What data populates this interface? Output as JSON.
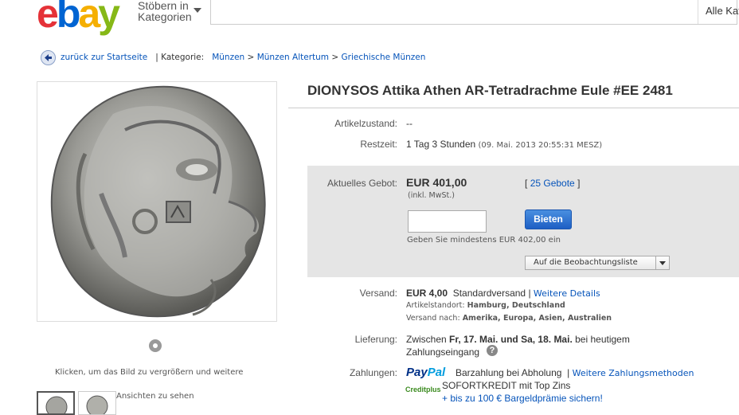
{
  "header": {
    "logo_letters": [
      "e",
      "b",
      "a",
      "y"
    ],
    "logo_colors": [
      "#e53238",
      "#0064d2",
      "#f5af02",
      "#86b817"
    ],
    "browse_line1": "Stöbern in",
    "browse_line2": "Kategorien",
    "category_select": "Alle Kat"
  },
  "breadcrumb": {
    "back_label": "zurück zur Startseite",
    "separator": "|",
    "category_label": "Kategorie:",
    "items": [
      "Münzen",
      "Münzen Altertum",
      "Griechische Münzen"
    ],
    "arrow": ">"
  },
  "gallery": {
    "hint_line1": "Klicken, um das Bild zu vergrößern und weitere",
    "hint_line2": "Ansichten zu sehen"
  },
  "listing": {
    "title": "DIONYSOS Attika Athen AR-Tetradrachme Eule #EE 2481",
    "condition_label": "Artikelzustand:",
    "condition_value": "--",
    "time_label": "Restzeit:",
    "time_value": "1 Tag 3 Stunden",
    "time_end": "(09. Mai. 2013  20:55:31 MESZ)"
  },
  "bidding": {
    "current_label": "Aktuelles Gebot:",
    "price": "EUR 401,00",
    "price_note": "(inkl. MwSt.)",
    "bids_open": "[",
    "bids_link": "25 Gebote",
    "bids_close": "]",
    "bid_input_value": "",
    "bid_button": "Bieten",
    "min_bid_note": "Geben Sie mindestens EUR 402,00 ein",
    "watch_button": "Auf die Beobachtungsliste"
  },
  "shipping": {
    "label": "Versand:",
    "cost": "EUR 4,00",
    "method": "Standardversand",
    "sep": "|",
    "details_link": "Weitere Details",
    "location_label": "Artikelstandort:",
    "location_value": "Hamburg, Deutschland",
    "ships_to_label": "Versand nach:",
    "ships_to_value": "Amerika, Europa, Asien, Australien"
  },
  "delivery": {
    "label": "Lieferung:",
    "prefix": "Zwischen",
    "date_from": "Fr, 17. Mai.",
    "connector": "und",
    "date_to": "Sa, 18. Mai.",
    "suffix": "bei heutigem",
    "line2": "Zahlungseingang",
    "help_icon": "?"
  },
  "payments": {
    "label": "Zahlungen:",
    "paypal_1": "Pay",
    "paypal_2": "Pal",
    "cash": "Barzahlung bei Abholung",
    "sep": "|",
    "more_link": "Weitere Zahlungsmethoden",
    "creditplus_logo": "Creditplus",
    "sofort": "SOFORTKREDIT mit Top Zins",
    "bonus": "+ bis zu 100 € Bargeldprämie sichern!"
  }
}
